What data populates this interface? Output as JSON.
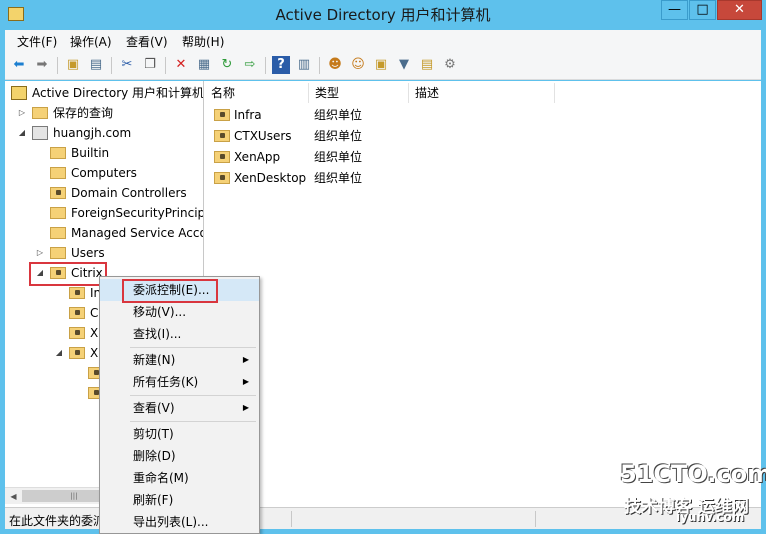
{
  "window": {
    "title": "Active Directory 用户和计算机",
    "controls": {
      "minimize": "—",
      "maximize": "□",
      "close": "✕"
    }
  },
  "menubar": {
    "items": [
      "文件(F)",
      "操作(A)",
      "查看(V)",
      "帮助(H)"
    ]
  },
  "toolbar": {
    "icons": [
      "back-icon",
      "forward-icon",
      "up-folder-icon",
      "show-tree-icon",
      "cut-icon",
      "copy-icon",
      "delete-icon",
      "properties-icon",
      "refresh-icon",
      "export-icon",
      "help-icon",
      "console-icon",
      "new-user-icon",
      "new-group-icon",
      "new-ou-icon",
      "filter-icon",
      "add-to-group-icon",
      "delegate-icon"
    ]
  },
  "tree": {
    "root": "Active Directory 用户和计算机",
    "saved_queries": "保存的查询",
    "domain": "huangjh.com",
    "children": [
      "Builtin",
      "Computers",
      "Domain Controllers",
      "ForeignSecurityPrincipa",
      "Managed Service Acco",
      "Users"
    ],
    "citrix": "Citrix",
    "citrix_children": [
      "In",
      "C",
      "X",
      "X"
    ]
  },
  "list": {
    "columns": [
      "名称",
      "类型",
      "描述"
    ],
    "rows": [
      {
        "name": "Infra",
        "type": "组织单位"
      },
      {
        "name": "CTXUsers",
        "type": "组织单位"
      },
      {
        "name": "XenApp",
        "type": "组织单位"
      },
      {
        "name": "XenDesktop",
        "type": "组织单位"
      }
    ]
  },
  "context_menu": {
    "items": [
      "委派控制(E)...",
      "移动(V)...",
      "查找(I)...",
      "新建(N)",
      "所有任务(K)",
      "查看(V)",
      "剪切(T)",
      "删除(D)",
      "重命名(M)",
      "刷新(F)",
      "导出列表(L)..."
    ],
    "submenu_arrow": "▶"
  },
  "statusbar": {
    "text": "在此文件夹的委派"
  },
  "watermark": {
    "brand": "51CTO.com",
    "tagline": "技术博客  运维网",
    "url": "iyunv.com"
  },
  "colors": {
    "accent": "#5ec1ec",
    "highlight_box": "#d9363e",
    "menu_bg": "#f5f6f7",
    "close_button": "#c7483b"
  }
}
